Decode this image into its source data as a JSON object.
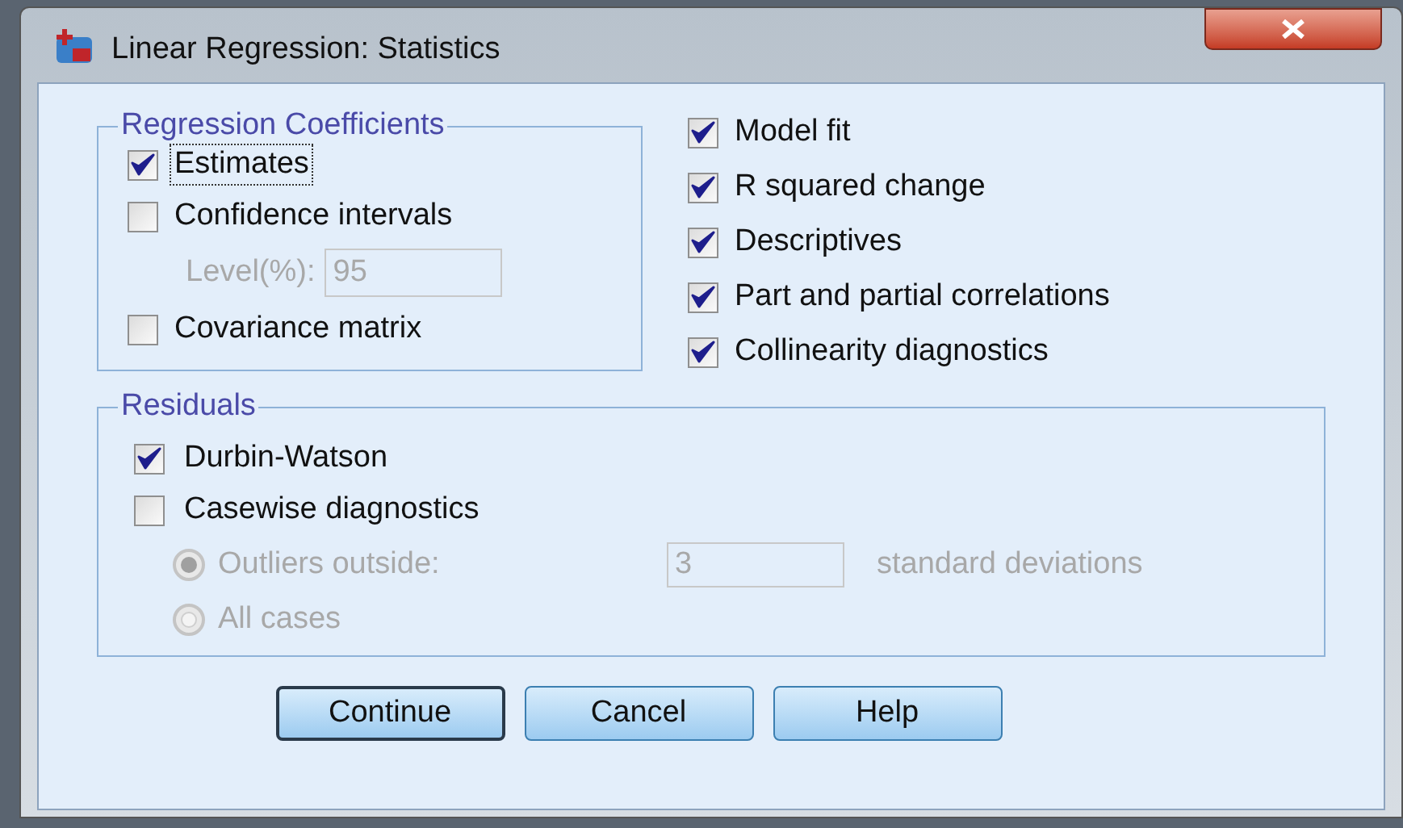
{
  "window": {
    "title": "Linear Regression: Statistics"
  },
  "coefficients": {
    "title": "Regression Coefficients",
    "items": [
      {
        "kind": "checkbox",
        "label": "Estimates",
        "checked": true,
        "focused": true
      },
      {
        "kind": "checkbox",
        "label": "Confidence intervals",
        "checked": false,
        "focused": false
      },
      {
        "kind": "field",
        "label": "Level(%):",
        "value": "95",
        "disabled": true
      },
      {
        "kind": "checkbox",
        "label": "Covariance matrix",
        "checked": false,
        "focused": false
      }
    ]
  },
  "options": [
    {
      "label": "Model fit",
      "checked": true
    },
    {
      "label": "R squared change",
      "checked": true
    },
    {
      "label": "Descriptives",
      "checked": true
    },
    {
      "label": "Part and partial correlations",
      "checked": true
    },
    {
      "label": "Collinearity diagnostics",
      "checked": true
    }
  ],
  "residuals": {
    "title": "Residuals",
    "checks": [
      {
        "label": "Durbin-Watson",
        "checked": true
      },
      {
        "label": "Casewise diagnostics",
        "checked": false
      }
    ],
    "radios": [
      {
        "label": "Outliers outside:",
        "selected": true,
        "disabled": true,
        "value": "3",
        "suffix": "standard deviations"
      },
      {
        "label": "All cases",
        "selected": false,
        "disabled": true
      }
    ]
  },
  "buttons": [
    {
      "label": "Continue",
      "default": true
    },
    {
      "label": "Cancel",
      "default": false
    },
    {
      "label": "Help",
      "default": false
    }
  ]
}
